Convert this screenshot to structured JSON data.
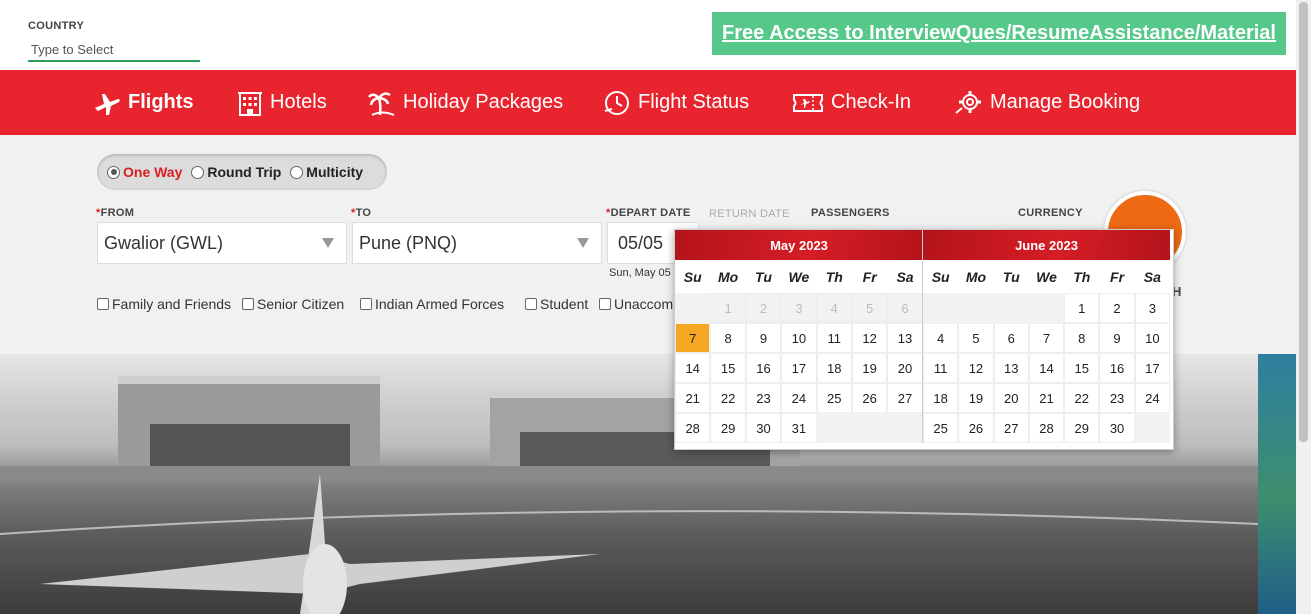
{
  "country": {
    "label": "COUNTRY",
    "placeholder": "Type to Select"
  },
  "promo": {
    "text": "Free Access to InterviewQues/ResumeAssistance/Material"
  },
  "nav": {
    "items": [
      {
        "label": "Flights",
        "icon": "plane-icon"
      },
      {
        "label": "Hotels",
        "icon": "hotel-icon"
      },
      {
        "label": "Holiday Packages",
        "icon": "palm-tree-icon"
      },
      {
        "label": "Flight Status",
        "icon": "clock-plane-icon"
      },
      {
        "label": "Check-In",
        "icon": "ticket-icon"
      },
      {
        "label": "Manage Booking",
        "icon": "gear-icon"
      }
    ]
  },
  "trip": {
    "one_way": "One Way",
    "round_trip": "Round Trip",
    "multicity": "Multicity",
    "selected": "One Way"
  },
  "form": {
    "from_label": "FROM",
    "from_value": "Gwalior (GWL)",
    "to_label": "TO",
    "to_value": "Pune (PNQ)",
    "depart_label": "DEPART DATE",
    "depart_value": "05/05",
    "depart_sub": "Sun, May 05",
    "return_label": "RETURN DATE",
    "passengers_label": "PASSENGERS",
    "currency_label": "CURRENCY",
    "search_partial": "H"
  },
  "checks": {
    "family": "Family and Friends",
    "senior": "Senior Citizen",
    "armed": "Indian Armed Forces",
    "student": "Student",
    "unaccompanied": "Unaccom"
  },
  "calendar": {
    "dow": [
      "Su",
      "Mo",
      "Tu",
      "We",
      "Th",
      "Fr",
      "Sa"
    ],
    "months": [
      {
        "title": "May 2023",
        "weeks": [
          [
            "",
            "1",
            "2",
            "3",
            "4",
            "5",
            "6"
          ],
          [
            "7",
            "8",
            "9",
            "10",
            "11",
            "12",
            "13"
          ],
          [
            "14",
            "15",
            "16",
            "17",
            "18",
            "19",
            "20"
          ],
          [
            "21",
            "22",
            "23",
            "24",
            "25",
            "26",
            "27"
          ],
          [
            "28",
            "29",
            "30",
            "31",
            "",
            "",
            ""
          ]
        ],
        "past": [
          "1",
          "2",
          "3",
          "4",
          "5",
          "6"
        ],
        "today": "7"
      },
      {
        "title": "June 2023",
        "weeks": [
          [
            "",
            "",
            "",
            "",
            "1",
            "2",
            "3"
          ],
          [
            "4",
            "5",
            "6",
            "7",
            "8",
            "9",
            "10"
          ],
          [
            "11",
            "12",
            "13",
            "14",
            "15",
            "16",
            "17"
          ],
          [
            "18",
            "19",
            "20",
            "21",
            "22",
            "23",
            "24"
          ],
          [
            "25",
            "26",
            "27",
            "28",
            "29",
            "30",
            ""
          ]
        ],
        "past": [],
        "today": ""
      }
    ]
  },
  "colors": {
    "nav_red": "#e8252e",
    "promo_green": "#56c98a",
    "today": "#f5a623",
    "search_orange": "#ee6a14"
  }
}
